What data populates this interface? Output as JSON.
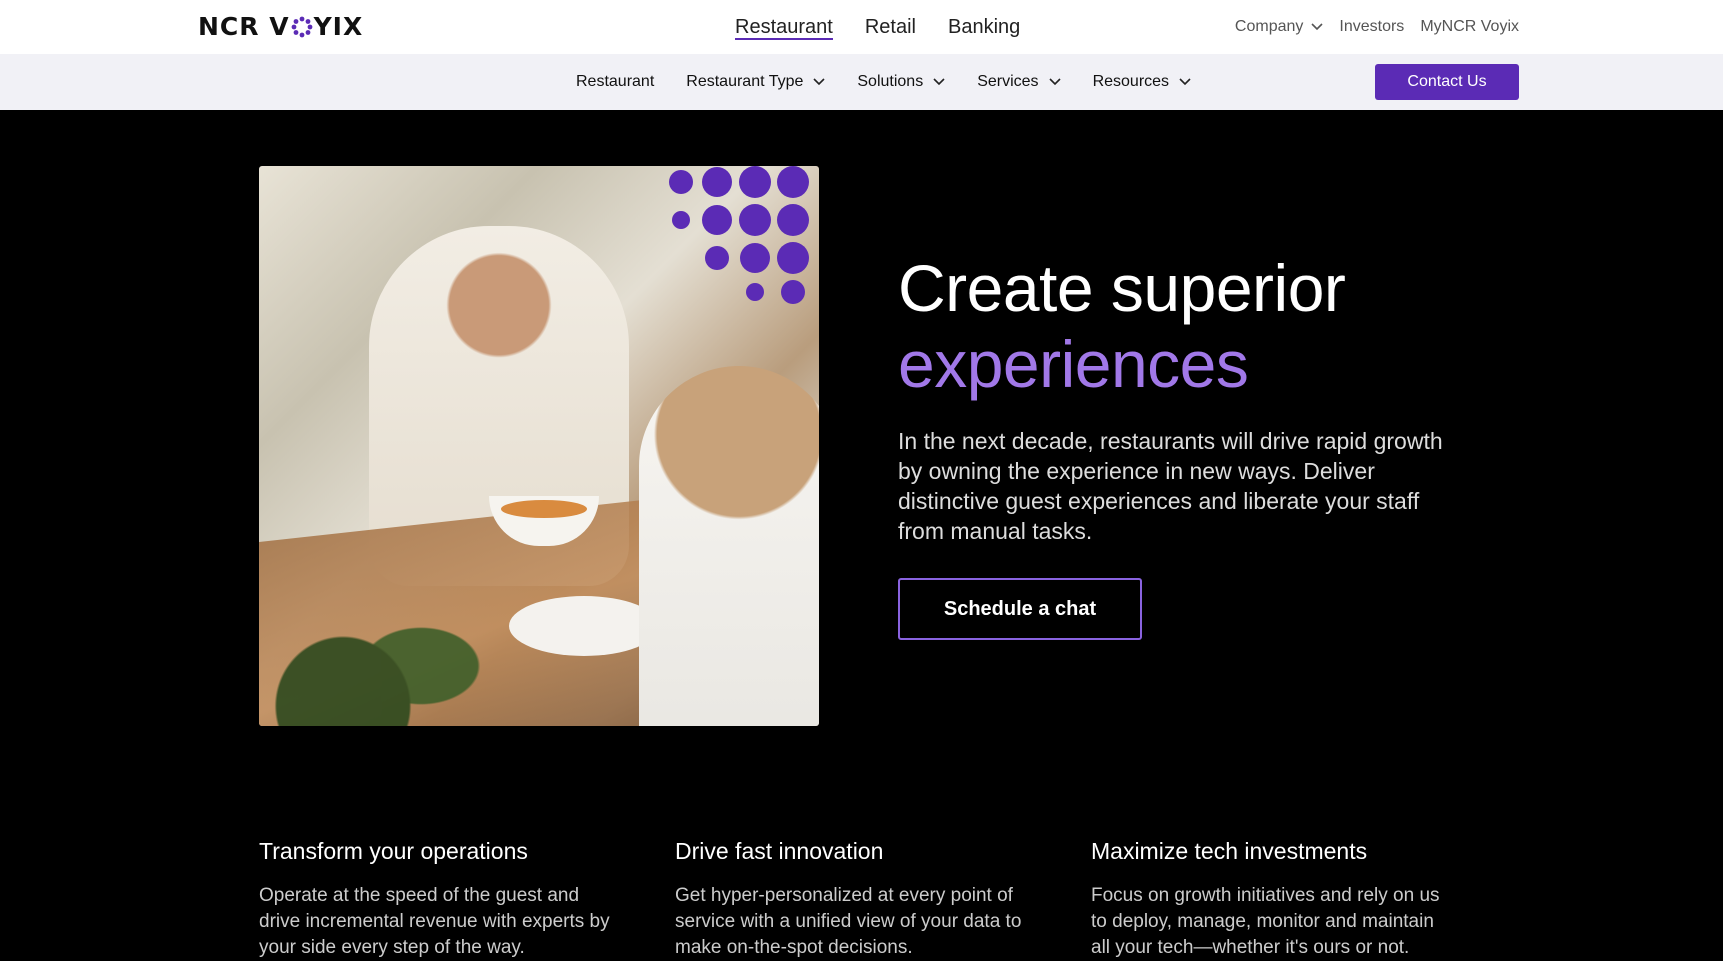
{
  "brand": {
    "logo_text_left": "NCR V",
    "logo_text_right": "YIX",
    "accent": "#5b2bb5",
    "accent_light": "#a178e8"
  },
  "primary_nav": {
    "tabs": [
      "Restaurant",
      "Retail",
      "Banking"
    ],
    "active": "Restaurant"
  },
  "utility_nav": {
    "company": "Company",
    "investors": "Investors",
    "mynrc": "MyNCR Voyix"
  },
  "sub_nav": {
    "restaurant": "Restaurant",
    "restaurant_type": "Restaurant Type",
    "solutions": "Solutions",
    "services": "Services",
    "resources": "Resources",
    "contact": "Contact Us"
  },
  "hero": {
    "title_line1": "Create superior",
    "title_line2": "experiences",
    "body": "In the next decade, restaurants will drive rapid growth by owning the experience in new ways. Deliver distinctive guest experiences and liberate your staff from manual tasks.",
    "cta": "Schedule a chat"
  },
  "features": [
    {
      "title": "Transform your operations",
      "body": "Operate at the speed of the guest and drive incremental revenue with experts by your side every step of the way."
    },
    {
      "title": "Drive fast innovation",
      "body": "Get hyper-personalized at every point of service with a unified view of your data to make on-the-spot decisions."
    },
    {
      "title": "Maximize tech investments",
      "body": "Focus on growth initiatives and rely on us to deploy, manage, monitor and maintain all your tech—whether it's ours or not."
    }
  ]
}
